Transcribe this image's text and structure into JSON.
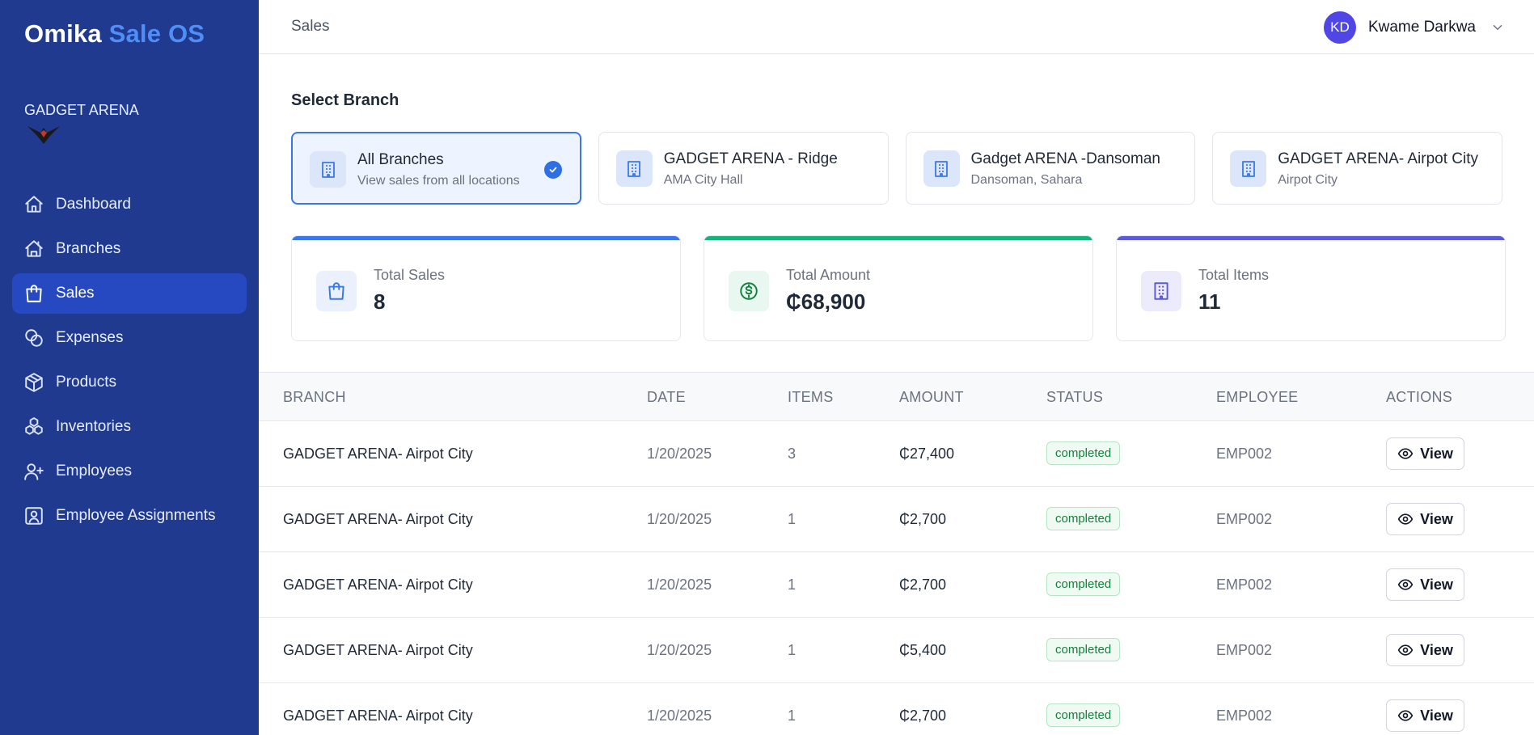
{
  "app": {
    "brand_part1": "Omika",
    "brand_part2": "Sale OS"
  },
  "org": {
    "name": "GADGET ARENA"
  },
  "nav": {
    "items": [
      {
        "label": "Dashboard",
        "icon": "home-icon"
      },
      {
        "label": "Branches",
        "icon": "store-icon"
      },
      {
        "label": "Sales",
        "icon": "shopping-bag-icon",
        "active": true
      },
      {
        "label": "Expenses",
        "icon": "coins-icon"
      },
      {
        "label": "Products",
        "icon": "package-icon"
      },
      {
        "label": "Inventories",
        "icon": "boxes-icon"
      },
      {
        "label": "Employees",
        "icon": "user-plus-icon"
      },
      {
        "label": "Employee Assignments",
        "icon": "id-badge-icon"
      }
    ]
  },
  "header": {
    "breadcrumb": "Sales",
    "user_initials": "KD",
    "user_name": "Kwame Darkwa"
  },
  "branch_select": {
    "title": "Select Branch",
    "cards": [
      {
        "name": "All Branches",
        "sub": "View sales from all locations",
        "selected": true
      },
      {
        "name": "GADGET ARENA - Ridge",
        "sub": "AMA City Hall"
      },
      {
        "name": "Gadget ARENA -Dansoman",
        "sub": "Dansoman, Sahara"
      },
      {
        "name": "GADGET ARENA- Airpot City",
        "sub": "Airpot City"
      }
    ]
  },
  "stats": [
    {
      "label": "Total Sales",
      "value": "8",
      "color": "#3b78e7",
      "icon": "shopping-bag-icon"
    },
    {
      "label": "Total Amount",
      "value": "₵68,900",
      "color": "#16b47a",
      "icon": "dollar-circle-icon"
    },
    {
      "label": "Total Items",
      "value": "11",
      "color": "#5b5bd6",
      "icon": "building-icon"
    }
  ],
  "table": {
    "headers": {
      "branch": "BRANCH",
      "date": "DATE",
      "items": "ITEMS",
      "amount": "AMOUNT",
      "status": "STATUS",
      "employee": "EMPLOYEE",
      "actions": "ACTIONS"
    },
    "rows": [
      {
        "branch": "GADGET ARENA- Airpot City",
        "date": "1/20/2025",
        "items": "3",
        "amount": "₵27,400",
        "status": "completed",
        "employee": "EMP002",
        "action": "View"
      },
      {
        "branch": "GADGET ARENA- Airpot City",
        "date": "1/20/2025",
        "items": "1",
        "amount": "₵2,700",
        "status": "completed",
        "employee": "EMP002",
        "action": "View"
      },
      {
        "branch": "GADGET ARENA- Airpot City",
        "date": "1/20/2025",
        "items": "1",
        "amount": "₵2,700",
        "status": "completed",
        "employee": "EMP002",
        "action": "View"
      },
      {
        "branch": "GADGET ARENA- Airpot City",
        "date": "1/20/2025",
        "items": "1",
        "amount": "₵5,400",
        "status": "completed",
        "employee": "EMP002",
        "action": "View"
      },
      {
        "branch": "GADGET ARENA- Airpot City",
        "date": "1/20/2025",
        "items": "1",
        "amount": "₵2,700",
        "status": "completed",
        "employee": "EMP002",
        "action": "View"
      }
    ]
  }
}
